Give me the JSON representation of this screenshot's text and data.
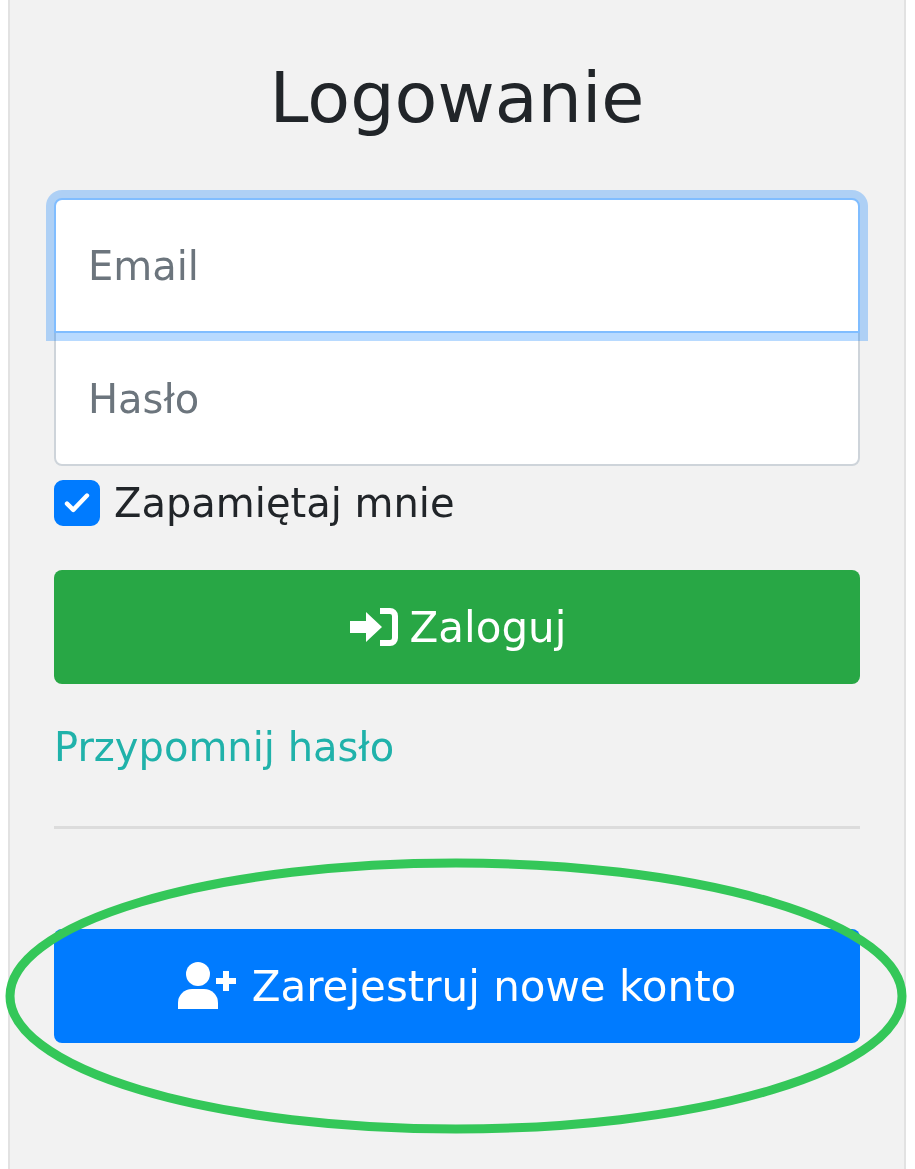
{
  "title": "Logowanie",
  "fields": [
    {
      "placeholder": "Email",
      "focused": true
    },
    {
      "placeholder": "Hasło",
      "focused": false
    }
  ],
  "remember": {
    "label": "Zapamiętaj mnie",
    "checked": true
  },
  "login_button": {
    "label": "Zaloguj"
  },
  "forgot_link": "Przypomnij hasło",
  "register_button": {
    "label": "Zarejestruj nowe konto",
    "highlighted": true
  }
}
